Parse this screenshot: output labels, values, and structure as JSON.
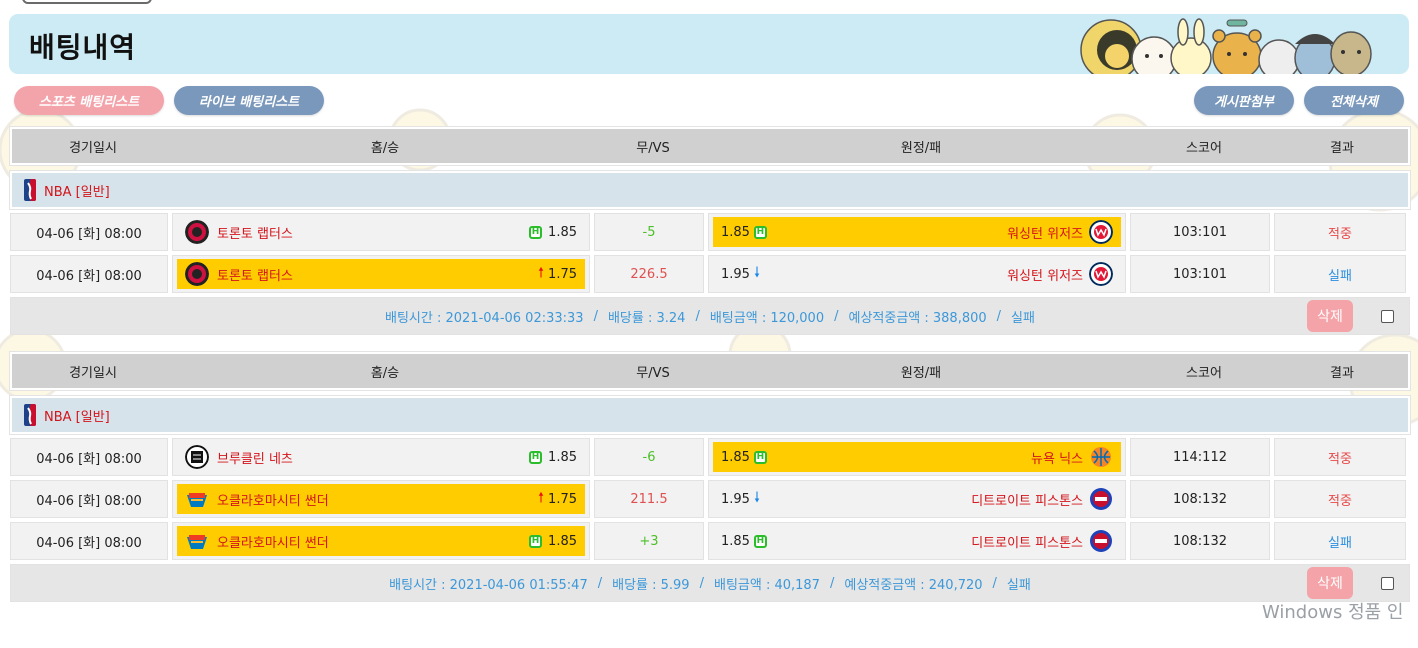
{
  "page": {
    "title": "배팅내역",
    "tabs": [
      {
        "label": "스포츠 배팅리스트",
        "color": "#f3a3aa"
      },
      {
        "label": "라이브 배팅리스트",
        "color": "#7a98bb"
      }
    ],
    "actions": [
      {
        "label": "게시판첨부",
        "color": "#7a98bb"
      },
      {
        "label": "전체삭제",
        "color": "#7a98bb"
      }
    ]
  },
  "table_headers": [
    "경기일시",
    "홈/승",
    "무/VS",
    "원정/패",
    "스코어",
    "결과"
  ],
  "bets": [
    {
      "league": "NBA [일반]",
      "games": [
        {
          "date": "04-06 [화] 08:00",
          "home": "토론토 랩터스",
          "home_logo": "raptors-logo-icon",
          "home_odds": "1.85",
          "home_marker": "H",
          "home_selected": false,
          "vs": "-5",
          "vs_color": "green",
          "away_odds": "1.85",
          "away_marker": "H",
          "away": "워싱턴 위저즈",
          "away_logo": "wizards-logo-icon",
          "away_selected": true,
          "score": "103:101",
          "result": "적중"
        },
        {
          "date": "04-06 [화] 08:00",
          "home": "토론토 랩터스",
          "home_logo": "raptors-logo-icon",
          "home_odds": "1.75",
          "home_marker": "up",
          "home_selected": true,
          "vs": "226.5",
          "vs_color": "red",
          "away_odds": "1.95",
          "away_marker": "down",
          "away": "워싱턴 위저즈",
          "away_logo": "wizards-logo-icon",
          "away_selected": false,
          "score": "103:101",
          "result": "실패"
        }
      ],
      "summary": {
        "bet_time": "배팅시간 : 2021-04-06 02:33:33",
        "odds": "배당률 : 3.24",
        "amount": "배팅금액 : 120,000",
        "expected": "예상적중금액 : 388,800",
        "status": "실패"
      },
      "delete_label": "삭제"
    },
    {
      "league": "NBA [일반]",
      "games": [
        {
          "date": "04-06 [화] 08:00",
          "home": "브루클린 네츠",
          "home_logo": "nets-logo-icon",
          "home_odds": "1.85",
          "home_marker": "H",
          "home_selected": false,
          "vs": "-6",
          "vs_color": "green",
          "away_odds": "1.85",
          "away_marker": "H",
          "away": "뉴욕 닉스",
          "away_logo": "knicks-logo-icon",
          "away_selected": true,
          "score": "114:112",
          "result": "적중"
        },
        {
          "date": "04-06 [화] 08:00",
          "home": "오클라호마시티 썬더",
          "home_logo": "thunder-logo-icon",
          "home_odds": "1.75",
          "home_marker": "up",
          "home_selected": true,
          "vs": "211.5",
          "vs_color": "red",
          "away_odds": "1.95",
          "away_marker": "down",
          "away": "디트로이트 피스톤스",
          "away_logo": "pistons-logo-icon",
          "away_selected": false,
          "score": "108:132",
          "result": "적중"
        },
        {
          "date": "04-06 [화] 08:00",
          "home": "오클라호마시티 썬더",
          "home_logo": "thunder-logo-icon",
          "home_odds": "1.85",
          "home_marker": "H",
          "home_selected": true,
          "vs": "+3",
          "vs_color": "green",
          "away_odds": "1.85",
          "away_marker": "H",
          "away": "디트로이트 피스톤스",
          "away_logo": "pistons-logo-icon",
          "away_selected": false,
          "score": "108:132",
          "result": "실패"
        }
      ],
      "summary": {
        "bet_time": "배팅시간 : 2021-04-06 01:55:47",
        "odds": "배당률 : 5.99",
        "amount": "배팅금액 : 40,187",
        "expected": "예상적중금액 : 240,720",
        "status": "실패"
      },
      "delete_label": "삭제"
    }
  ],
  "watermark": "Windows 정품 인",
  "colors": {
    "banner": "#cdebf4",
    "selected": "#ffcc00",
    "team": "#d4141b",
    "hit": "#e84a4a",
    "miss": "#2c8fe0",
    "summary_text": "#3c98d9"
  }
}
